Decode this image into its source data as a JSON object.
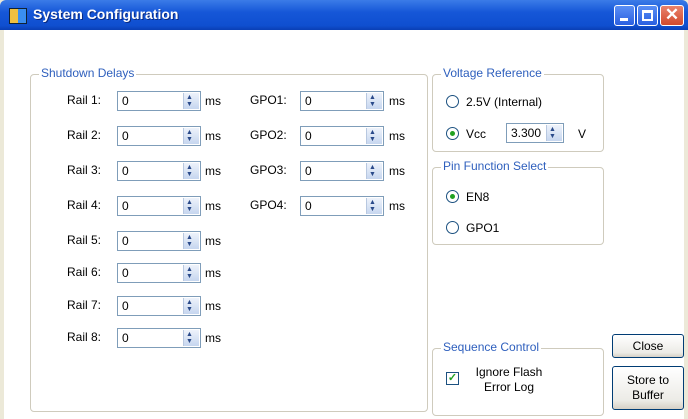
{
  "window": {
    "title": "System Configuration"
  },
  "shutdown": {
    "title": "Shutdown Delays",
    "unit": "ms",
    "rails": [
      {
        "label": "Rail 1:",
        "value": "0"
      },
      {
        "label": "Rail 2:",
        "value": "0"
      },
      {
        "label": "Rail 3:",
        "value": "0"
      },
      {
        "label": "Rail 4:",
        "value": "0"
      },
      {
        "label": "Rail 5:",
        "value": "0"
      },
      {
        "label": "Rail 6:",
        "value": "0"
      },
      {
        "label": "Rail 7:",
        "value": "0"
      },
      {
        "label": "Rail 8:",
        "value": "0"
      }
    ],
    "gpos": [
      {
        "label": "GPO1:",
        "value": "0"
      },
      {
        "label": "GPO2:",
        "value": "0"
      },
      {
        "label": "GPO3:",
        "value": "0"
      },
      {
        "label": "GPO4:",
        "value": "0"
      }
    ]
  },
  "voltage": {
    "title": "Voltage Reference",
    "option_internal": "2.5V (Internal)",
    "option_vcc": "Vcc",
    "selected": "vcc",
    "vcc_value": "3.300",
    "vcc_unit": "V"
  },
  "pin": {
    "title": "Pin Function Select",
    "option_en8": "EN8",
    "option_gpo1": "GPO1",
    "selected": "en8"
  },
  "sequence": {
    "title": "Sequence Control",
    "ignore_label_line1": "Ignore Flash",
    "ignore_label_line2": "Error Log",
    "ignore_checked": true
  },
  "buttons": {
    "close": "Close",
    "store_line1": "Store to",
    "store_line2": "Buffer"
  },
  "colors": {
    "title_bar": "#0f4fd0",
    "group_label": "#2e5fbd",
    "client": "#ffffff"
  }
}
